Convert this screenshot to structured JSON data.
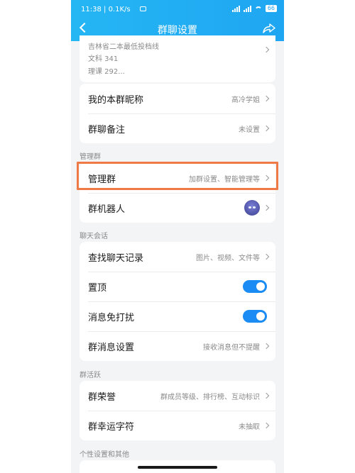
{
  "status_bar": {
    "time": "11:38",
    "speed": "0.1K/s",
    "battery": "66"
  },
  "nav": {
    "title": "群聊设置"
  },
  "group_info": {
    "line1": "吉林省二本最低投档线",
    "line2": "文科 341",
    "line3": "理课 292..."
  },
  "profile": {
    "nickname_label": "我的本群昵称",
    "nickname_value": "高冷学姐",
    "remark_label": "群聊备注",
    "remark_value": "未设置"
  },
  "manage_section": {
    "header": "管理群",
    "manage_label": "管理群",
    "manage_value": "加群设置、智能管理等",
    "robot_label": "群机器人"
  },
  "chat_section": {
    "header": "聊天会话",
    "search_label": "查找聊天记录",
    "search_value": "图片、视频、文件等",
    "pin_label": "置顶",
    "mute_label": "消息免打扰",
    "msg_settings_label": "群消息设置",
    "msg_settings_value": "接收消息但不提醒"
  },
  "activity_section": {
    "header": "群活跃",
    "honor_label": "群荣誉",
    "honor_value": "群成员等级、排行榜、互动标识",
    "lucky_label": "群幸运字符",
    "lucky_value": "未抽取"
  },
  "other_section": {
    "header": "个性设置和其他"
  },
  "toggles": {
    "pin": true,
    "mute": true,
    "on_color": "#1b8cf3"
  },
  "colors": {
    "header": "#1fa6f2",
    "highlight": "#f07a47"
  }
}
